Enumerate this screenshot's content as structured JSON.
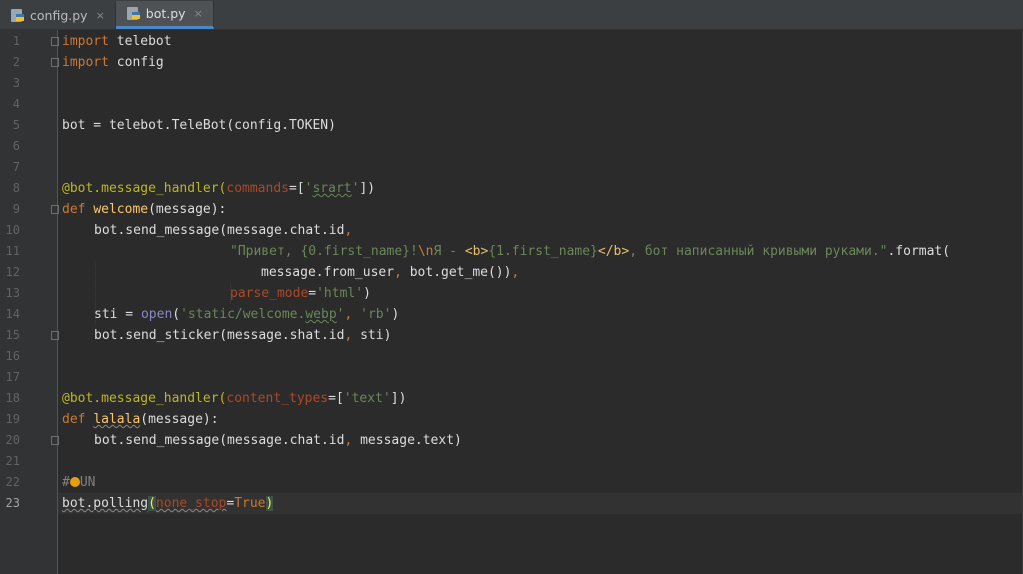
{
  "tabs": [
    {
      "label": "config.py",
      "icon": "python-file-icon",
      "active": false
    },
    {
      "label": "bot.py",
      "icon": "python-file-icon",
      "active": true
    }
  ],
  "tab_close_glyph": "×",
  "current_line": 23,
  "line_numbers": [
    "1",
    "2",
    "3",
    "4",
    "5",
    "6",
    "7",
    "8",
    "9",
    "10",
    "11",
    "12",
    "13",
    "14",
    "15",
    "16",
    "17",
    "18",
    "19",
    "20",
    "21",
    "22",
    "23"
  ],
  "code": {
    "l1": {
      "kw": "import",
      "rest": " telebot"
    },
    "l2": {
      "kw": "import",
      "rest": " config"
    },
    "l5": {
      "text": "bot = telebot.TeleBot(config.TOKEN)"
    },
    "l8": {
      "dec": "@bot.message_handler(",
      "param": "commands",
      "eq": "=[",
      "str_open": "'",
      "str_typo": "srart",
      "str_close": "'",
      "close": "])"
    },
    "l9": {
      "kw": "def",
      "fn": "welcome",
      "rest": "(message):"
    },
    "l10": {
      "text": "bot.send_message(message.chat.id",
      "comma": ","
    },
    "l11": {
      "s1": "\"Привет, {0.first_name}!",
      "esc": "\\n",
      "s2": "Я - ",
      "h1": "<b>",
      "s3": "{1.first_name}",
      "h2": "</b>",
      "s4": ", бот написанный кривыми руками.\"",
      "rest": ".format("
    },
    "l12": {
      "a": "message.from_user",
      "comma": ",",
      "b": " bot.get_me())",
      "comma2": ","
    },
    "l13": {
      "param": "parse_mode",
      "eq": "=",
      "str": "'html'",
      "close": ")"
    },
    "l14": {
      "a": "sti = ",
      "builtin": "open",
      "b": "(",
      "s1": "'static/welcome.",
      "s_typo": "webp",
      "s2": "'",
      "comma": ",",
      "s3": " 'rb'",
      "close": ")"
    },
    "l15": {
      "a": "bot.send_sticker(message.shat.id",
      "comma": ",",
      "b": " sti)"
    },
    "l18": {
      "dec": "@bot.message_handler(",
      "param": "content_types",
      "eq": "=[",
      "str": "'text'",
      "close": "])"
    },
    "l19": {
      "kw": "def",
      "fn": "lalala",
      "rest": "(message):"
    },
    "l20": {
      "a": "bot.send_message(message.chat.id",
      "comma": ",",
      "b": " message.text)"
    },
    "l22": {
      "c1": "#",
      "c2": "UN"
    },
    "l23": {
      "a": "bot.polling",
      "open": "(",
      "param": "none_stop",
      "eq": "=",
      "kw": "True",
      "close": ")"
    }
  },
  "colors": {
    "background": "#2b2b2b",
    "keyword": "#cc7832",
    "function": "#ffc66d",
    "decorator": "#bbb529",
    "string": "#6a8759",
    "parameter": "#aa4926",
    "comment": "#808080"
  }
}
